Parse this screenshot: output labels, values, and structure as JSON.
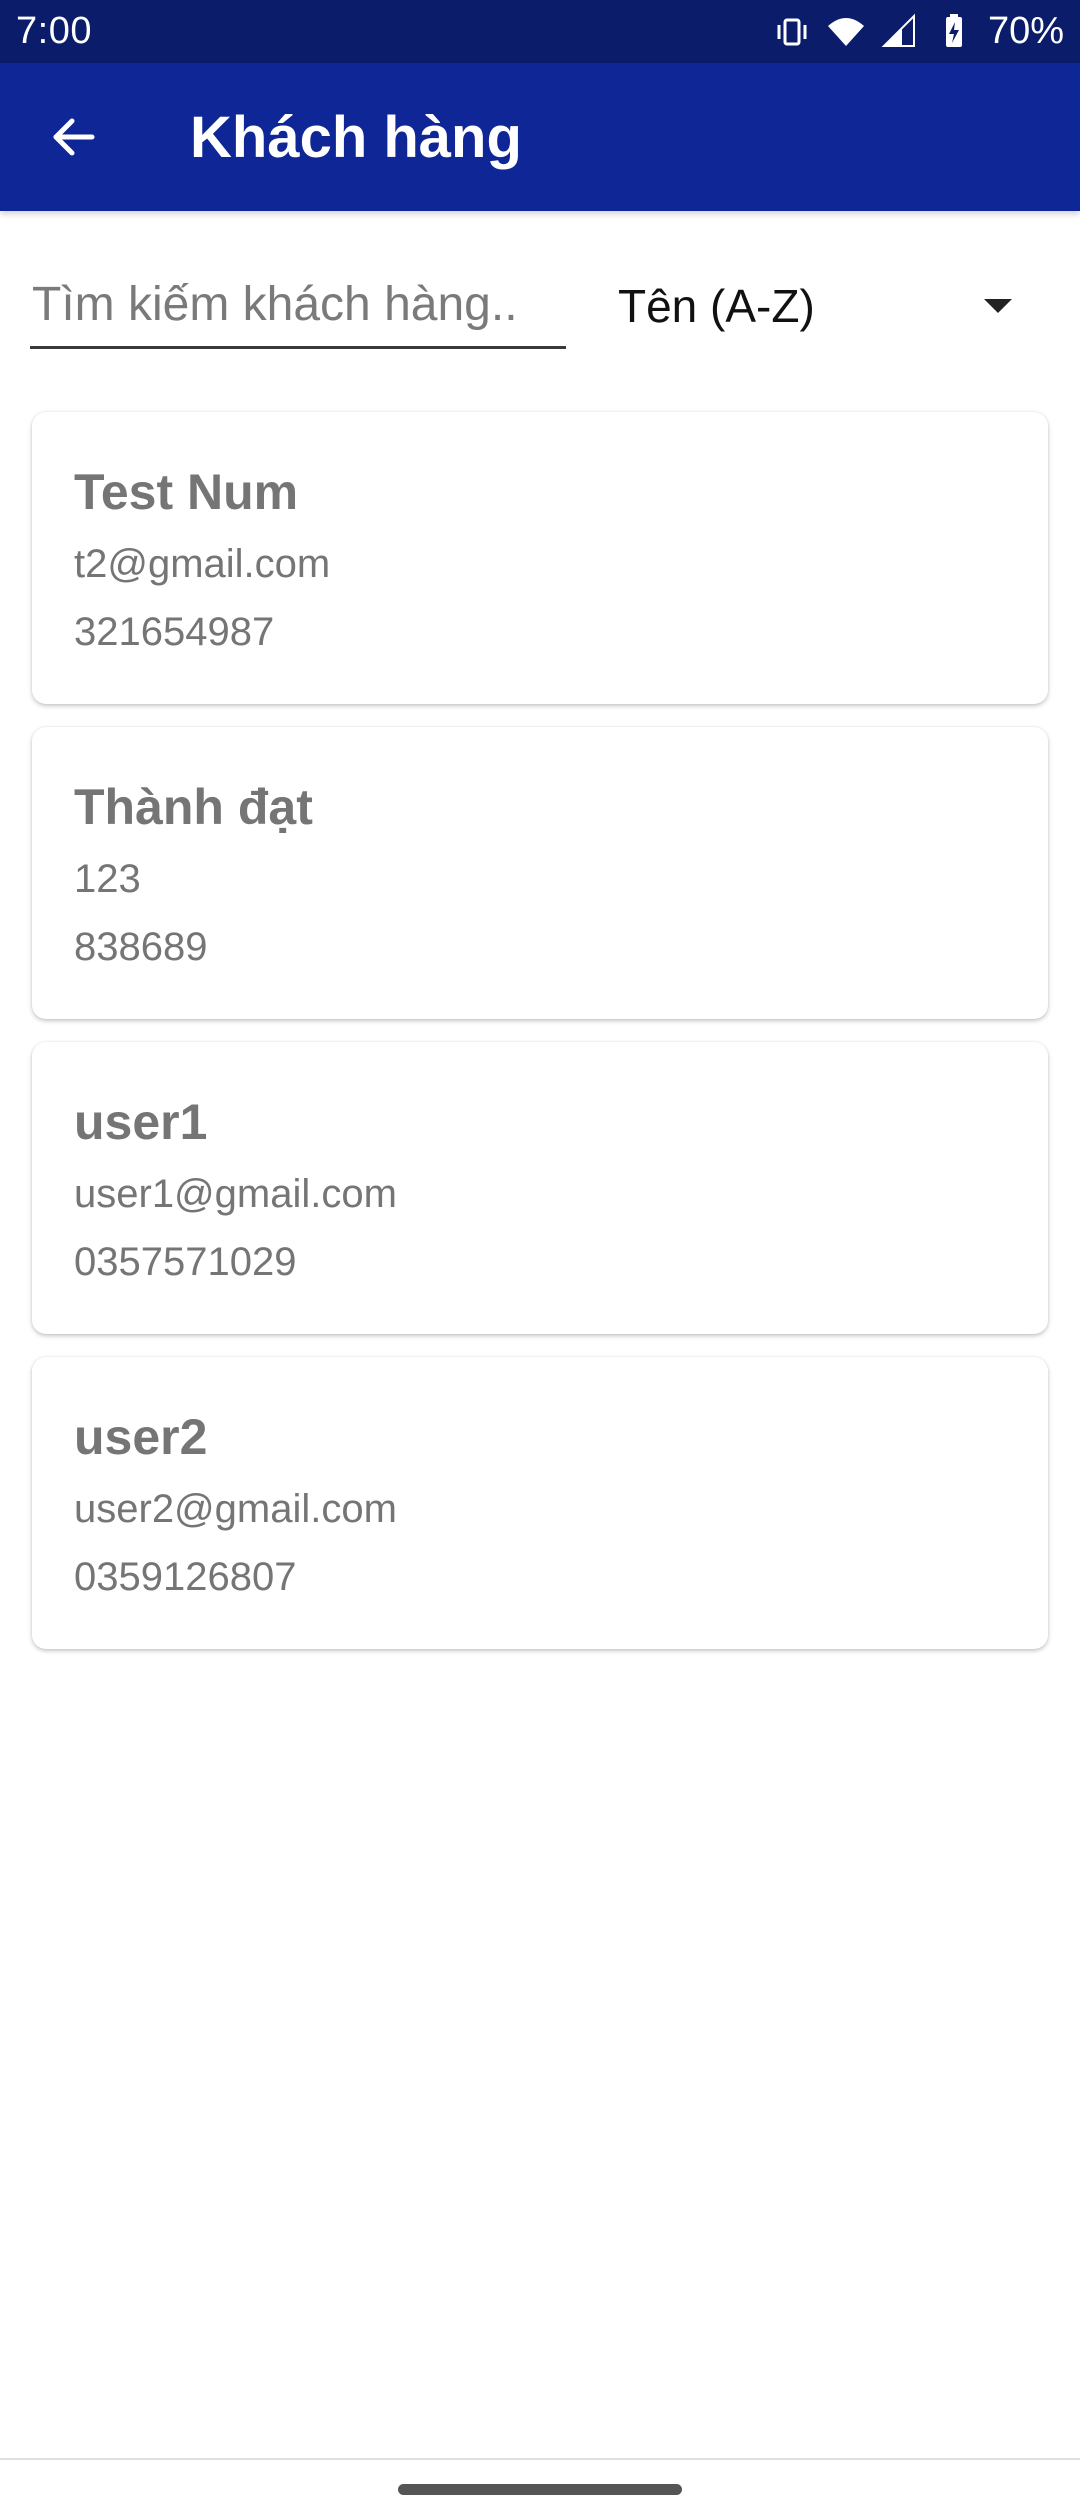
{
  "status_bar": {
    "time": "7:00",
    "battery": "70%",
    "icons": [
      "vibrate-icon",
      "wifi-icon",
      "cell-signal-icon",
      "battery-icon"
    ]
  },
  "app_bar": {
    "title": "Khách hàng",
    "back_icon": "arrow-back-icon",
    "background": "#0f2696"
  },
  "search": {
    "placeholder": "Tìm kiếm khách hàng..",
    "value": ""
  },
  "sort": {
    "selected": "Tên (A-Z)"
  },
  "customers": [
    {
      "name": "Test Num",
      "email": "t2@gmail.com",
      "phone": "321654987"
    },
    {
      "name": "Thành đạt",
      "email": "123",
      "phone": "838689"
    },
    {
      "name": "user1",
      "email": "user1@gmail.com",
      "phone": "0357571029"
    },
    {
      "name": "user2",
      "email": "user2@gmail.com",
      "phone": "0359126807"
    }
  ],
  "colors": {
    "status_bar": "#0b1c6b",
    "app_bar": "#0f2696",
    "card_text": "#757575"
  }
}
